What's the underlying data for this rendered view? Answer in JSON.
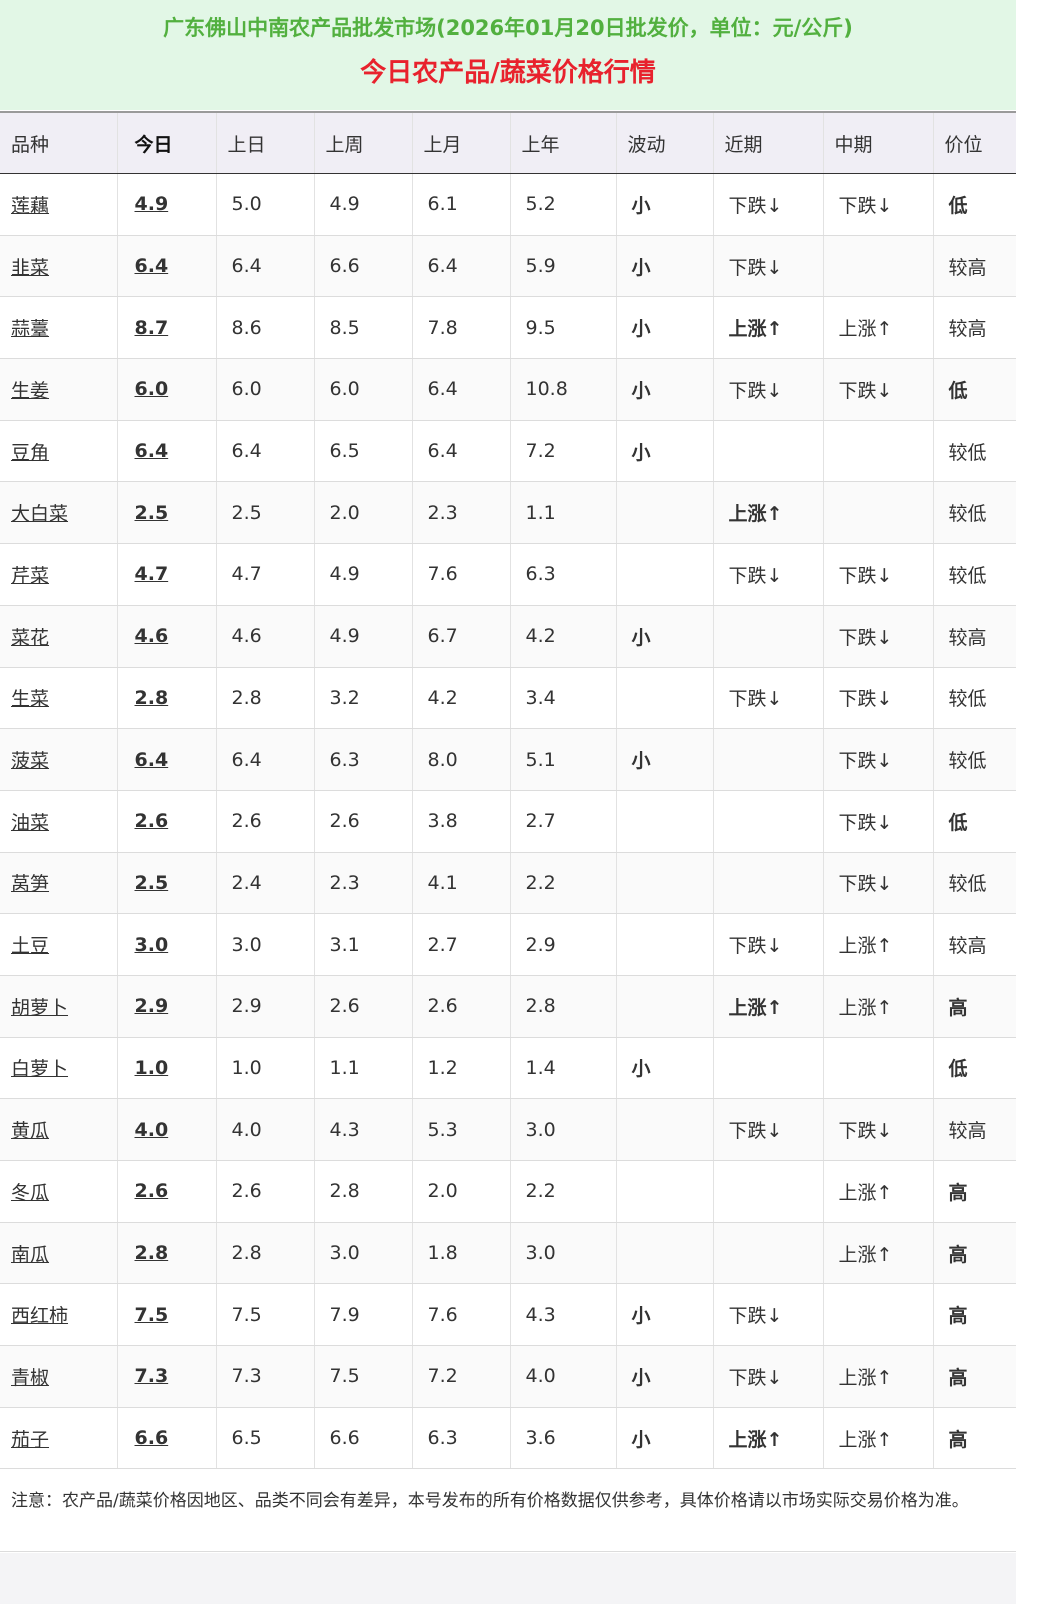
{
  "header": {
    "subtitle": "广东佛山中南农产品批发市场(2026年01月20日批发价，单位：元/公斤)",
    "title": "今日农产品/蔬菜价格行情"
  },
  "columns": [
    "品种",
    "今日",
    "上日",
    "上周",
    "上月",
    "上年",
    "波动",
    "近期",
    "中期",
    "价位"
  ],
  "rows": [
    {
      "name": "莲藕",
      "today": "4.9",
      "prev_day": "5.0",
      "prev_week": "4.9",
      "prev_month": "6.1",
      "prev_year": "5.2",
      "fluct": "小",
      "near": "下跌↓",
      "near_type": "down",
      "mid": "下跌↓",
      "mid_type": "down",
      "level": "低"
    },
    {
      "name": "韭菜",
      "today": "6.4",
      "prev_day": "6.4",
      "prev_week": "6.6",
      "prev_month": "6.4",
      "prev_year": "5.9",
      "fluct": "小",
      "near": "下跌↓",
      "near_type": "down",
      "mid": "",
      "mid_type": "",
      "level": "较高"
    },
    {
      "name": "蒜薹",
      "today": "8.7",
      "prev_day": "8.6",
      "prev_week": "8.5",
      "prev_month": "7.8",
      "prev_year": "9.5",
      "fluct": "小",
      "near": "上涨↑",
      "near_type": "up-green",
      "mid": "上涨↑",
      "mid_type": "up-teal",
      "level": "较高"
    },
    {
      "name": "生姜",
      "today": "6.0",
      "prev_day": "6.0",
      "prev_week": "6.0",
      "prev_month": "6.4",
      "prev_year": "10.8",
      "fluct": "小",
      "near": "下跌↓",
      "near_type": "down",
      "mid": "下跌↓",
      "mid_type": "down",
      "level": "低"
    },
    {
      "name": "豆角",
      "today": "6.4",
      "prev_day": "6.4",
      "prev_week": "6.5",
      "prev_month": "6.4",
      "prev_year": "7.2",
      "fluct": "小",
      "near": "",
      "near_type": "",
      "mid": "",
      "mid_type": "",
      "level": "较低"
    },
    {
      "name": "大白菜",
      "today": "2.5",
      "prev_day": "2.5",
      "prev_week": "2.0",
      "prev_month": "2.3",
      "prev_year": "1.1",
      "fluct": "",
      "near": "上涨↑",
      "near_type": "up-green",
      "mid": "",
      "mid_type": "",
      "level": "较低"
    },
    {
      "name": "芹菜",
      "today": "4.7",
      "prev_day": "4.7",
      "prev_week": "4.9",
      "prev_month": "7.6",
      "prev_year": "6.3",
      "fluct": "",
      "near": "下跌↓",
      "near_type": "down",
      "mid": "下跌↓",
      "mid_type": "down",
      "level": "较低"
    },
    {
      "name": "菜花",
      "today": "4.6",
      "prev_day": "4.6",
      "prev_week": "4.9",
      "prev_month": "6.7",
      "prev_year": "4.2",
      "fluct": "小",
      "near": "",
      "near_type": "",
      "mid": "下跌↓",
      "mid_type": "down",
      "level": "较高"
    },
    {
      "name": "生菜",
      "today": "2.8",
      "prev_day": "2.8",
      "prev_week": "3.2",
      "prev_month": "4.2",
      "prev_year": "3.4",
      "fluct": "",
      "near": "下跌↓",
      "near_type": "down",
      "mid": "下跌↓",
      "mid_type": "down",
      "level": "较低"
    },
    {
      "name": "菠菜",
      "today": "6.4",
      "prev_day": "6.4",
      "prev_week": "6.3",
      "prev_month": "8.0",
      "prev_year": "5.1",
      "fluct": "小",
      "near": "",
      "near_type": "",
      "mid": "下跌↓",
      "mid_type": "down",
      "level": "较低"
    },
    {
      "name": "油菜",
      "today": "2.6",
      "prev_day": "2.6",
      "prev_week": "2.6",
      "prev_month": "3.8",
      "prev_year": "2.7",
      "fluct": "",
      "near": "",
      "near_type": "",
      "mid": "下跌↓",
      "mid_type": "down",
      "level": "低"
    },
    {
      "name": "莴笋",
      "today": "2.5",
      "prev_day": "2.4",
      "prev_week": "2.3",
      "prev_month": "4.1",
      "prev_year": "2.2",
      "fluct": "",
      "near": "",
      "near_type": "",
      "mid": "下跌↓",
      "mid_type": "down",
      "level": "较低"
    },
    {
      "name": "土豆",
      "today": "3.0",
      "prev_day": "3.0",
      "prev_week": "3.1",
      "prev_month": "2.7",
      "prev_year": "2.9",
      "fluct": "",
      "near": "下跌↓",
      "near_type": "down",
      "mid": "上涨↑",
      "mid_type": "up-teal",
      "level": "较高"
    },
    {
      "name": "胡萝卜",
      "today": "2.9",
      "prev_day": "2.9",
      "prev_week": "2.6",
      "prev_month": "2.6",
      "prev_year": "2.8",
      "fluct": "",
      "near": "上涨↑",
      "near_type": "up-green",
      "mid": "上涨↑",
      "mid_type": "up-teal",
      "level": "高"
    },
    {
      "name": "白萝卜",
      "today": "1.0",
      "prev_day": "1.0",
      "prev_week": "1.1",
      "prev_month": "1.2",
      "prev_year": "1.4",
      "fluct": "小",
      "near": "",
      "near_type": "",
      "mid": "",
      "mid_type": "",
      "level": "低"
    },
    {
      "name": "黄瓜",
      "today": "4.0",
      "prev_day": "4.0",
      "prev_week": "4.3",
      "prev_month": "5.3",
      "prev_year": "3.0",
      "fluct": "",
      "near": "下跌↓",
      "near_type": "down",
      "mid": "下跌↓",
      "mid_type": "down",
      "level": "较高"
    },
    {
      "name": "冬瓜",
      "today": "2.6",
      "prev_day": "2.6",
      "prev_week": "2.8",
      "prev_month": "2.0",
      "prev_year": "2.2",
      "fluct": "",
      "near": "",
      "near_type": "",
      "mid": "上涨↑",
      "mid_type": "up-teal",
      "level": "高"
    },
    {
      "name": "南瓜",
      "today": "2.8",
      "prev_day": "2.8",
      "prev_week": "3.0",
      "prev_month": "1.8",
      "prev_year": "3.0",
      "fluct": "",
      "near": "",
      "near_type": "",
      "mid": "上涨↑",
      "mid_type": "up-teal",
      "level": "高"
    },
    {
      "name": "西红柿",
      "today": "7.5",
      "prev_day": "7.5",
      "prev_week": "7.9",
      "prev_month": "7.6",
      "prev_year": "4.3",
      "fluct": "小",
      "near": "下跌↓",
      "near_type": "down",
      "mid": "",
      "mid_type": "",
      "level": "高"
    },
    {
      "name": "青椒",
      "today": "7.3",
      "prev_day": "7.3",
      "prev_week": "7.5",
      "prev_month": "7.2",
      "prev_year": "4.0",
      "fluct": "小",
      "near": "下跌↓",
      "near_type": "down",
      "mid": "上涨↑",
      "mid_type": "up-teal",
      "level": "高"
    },
    {
      "name": "茄子",
      "today": "6.6",
      "prev_day": "6.5",
      "prev_week": "6.6",
      "prev_month": "6.3",
      "prev_year": "3.6",
      "fluct": "小",
      "near": "上涨↑",
      "near_type": "up-green",
      "mid": "上涨↑",
      "mid_type": "up-teal",
      "level": "高"
    }
  ],
  "note": "注意：农产品/蔬菜价格因地区、品类不同会有差异，本号发布的所有价格数据仅供参考，具体价格请以市场实际交易价格为准。",
  "colors": {
    "header_bg": "#e2f7e6",
    "subtitle": "#52b03f",
    "title": "#e8222d",
    "link": "#1b3fbd",
    "down": "#f0d238",
    "up": "#2fd176",
    "level_low": "#1d8f1d",
    "level_lower": "#59c46b",
    "level_higher": "#ef9a36",
    "level_high": "#e8222d"
  }
}
